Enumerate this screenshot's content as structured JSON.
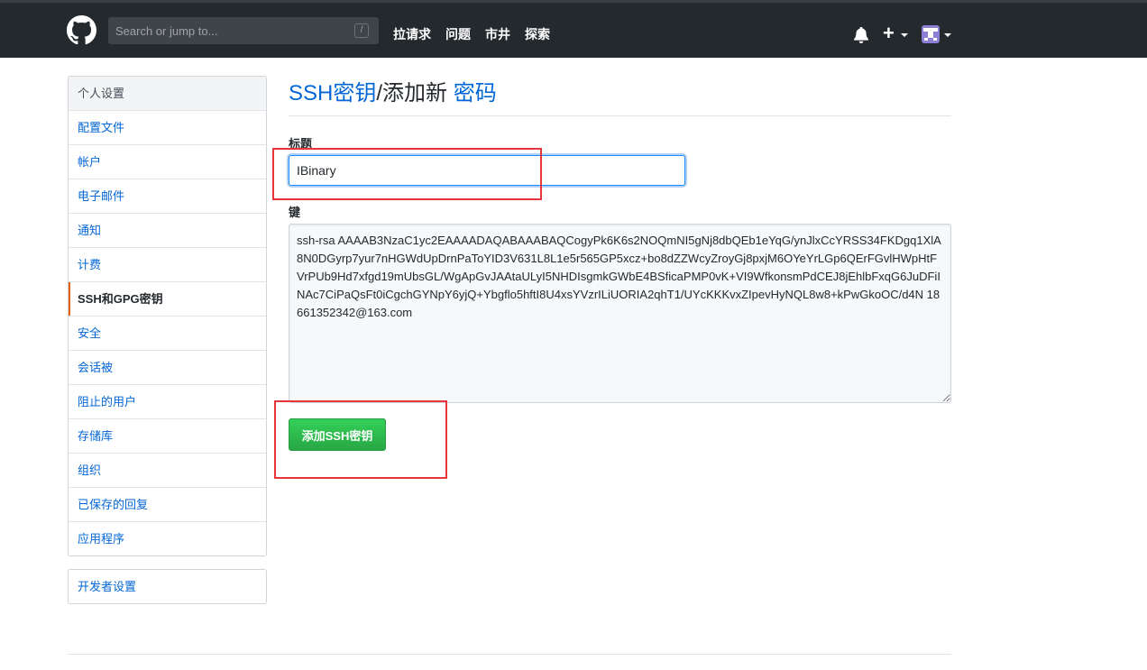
{
  "header": {
    "search_placeholder": "Search or jump to...",
    "search_shortcut": "/",
    "nav": [
      "拉请求",
      "问题",
      "市井",
      "探索"
    ],
    "new_label": "+"
  },
  "sidebar": {
    "heading": "个人设置",
    "items": [
      {
        "label": "配置文件"
      },
      {
        "label": "帐户"
      },
      {
        "label": "电子邮件"
      },
      {
        "label": "通知"
      },
      {
        "label": "计费"
      },
      {
        "label": "SSH和GPG密钥",
        "selected": true
      },
      {
        "label": "安全"
      },
      {
        "label": "会话被"
      },
      {
        "label": "阻止的用户"
      },
      {
        "label": "存储库"
      },
      {
        "label": "组织"
      },
      {
        "label": "已保存的回复"
      },
      {
        "label": "应用程序"
      }
    ],
    "developer_settings": "开发者设置"
  },
  "main": {
    "breadcrumb_link": "SSH密钥",
    "breadcrumb_sep": "/添加新",
    "breadcrumb_current": "密码",
    "title_label": "标题",
    "title_value": "IBinary",
    "key_label": "键",
    "key_value": "ssh-rsa AAAAB3NzaC1yc2EAAAADAQABAAABAQCogyPk6K6s2NOQmNI5gNj8dbQEb1eYqG/ynJlxCcYRSS34FKDgq1XlA8N0DGyrp7yur7nHGWdUpDrnPaToYID3V631L8L1e5r565GP5xcz+bo8dZZWcyZroyGj8pxjM6OYeYrLGp6QErFGvlHWpHtFVrPUb9Hd7xfgd19mUbsGL/WgApGvJAAtaULyI5NHDIsgmkGWbE4BSficaPMP0vK+VI9WfkonsmPdCEJ8jEhlbFxqG6JuDFiINAc7CiPaQsFt0iCgchGYNpY6yjQ+Ybgflo5hftI8U4xsYVzrILiUORIA2qhT1/UYcKKKvxZIpevHyNQL8w8+kPwGkoOC/d4N 18661352342@163.com",
    "submit_label": "添加SSH密钥"
  },
  "colors": {
    "header_bg": "#24292e",
    "link": "#0366d6",
    "primary_button": "#28a745",
    "annotation_box": "#e8343a",
    "selected_marker": "#e36209"
  },
  "icons": [
    "github-logo-icon",
    "bell-icon",
    "plus-icon",
    "chevron-down-icon",
    "avatar"
  ]
}
